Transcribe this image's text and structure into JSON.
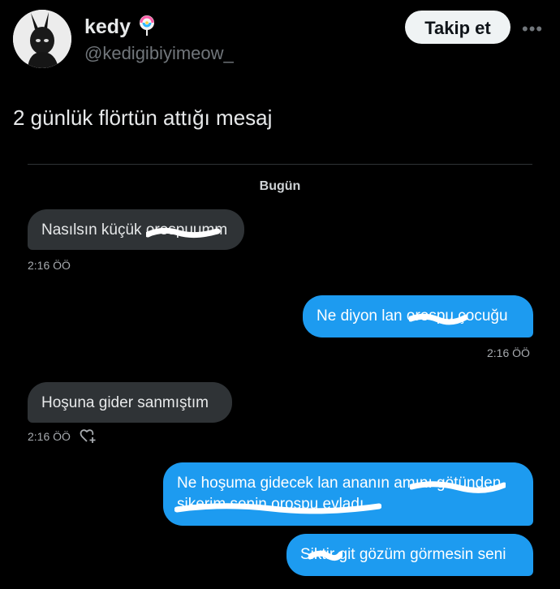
{
  "profile": {
    "name": "kedy",
    "emoji": "🍭",
    "handle": "@kedigibiyimeow_",
    "follow_label": "Takip et",
    "more_label": "•••"
  },
  "tweet_text": "2 günlük flörtün attığı mesaj",
  "dm": {
    "day_label": "Bugün",
    "messages": [
      {
        "direction": "in",
        "text": "Nasılsın küçük orospuumm",
        "time": "2:16 ÖÖ"
      },
      {
        "direction": "out",
        "text": "Ne diyon lan orospu çocuğu",
        "time": "2:16 ÖÖ"
      },
      {
        "direction": "in",
        "text": "Hoşuna gider sanmıştım",
        "time": "2:16 ÖÖ",
        "icon": "reaction-add-icon"
      },
      {
        "direction": "out",
        "text": "Ne hoşuma gidecek lan ananın amını götünden sikerim senin orospu evladı"
      },
      {
        "direction": "out",
        "text": "Siktir git gözüm görmesin seni"
      }
    ]
  },
  "colors": {
    "background": "#000000",
    "incoming_bubble": "#2f3336",
    "outgoing_bubble": "#1d9bf0",
    "follow_button": "#eff3f4",
    "secondary_text": "#71767b"
  }
}
